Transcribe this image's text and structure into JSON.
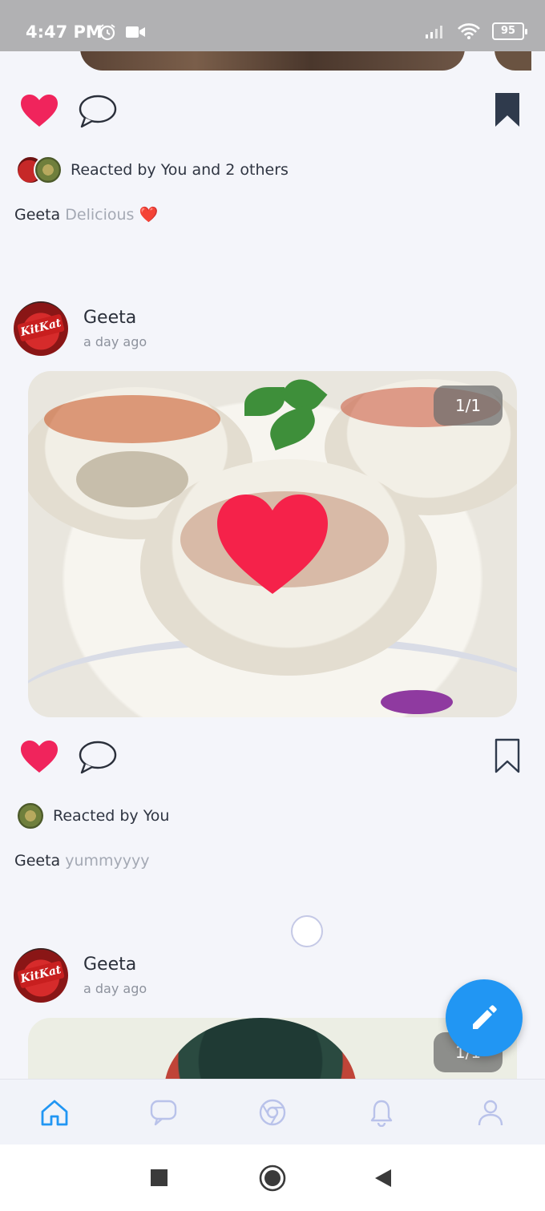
{
  "status_bar": {
    "time": "4:47 PM",
    "battery": "95",
    "icons": [
      "alarm-icon",
      "video-icon",
      "signal-icon",
      "wifi-icon",
      "battery-icon"
    ]
  },
  "feed": {
    "post_prev": {
      "reacted_text": "Reacted by You and 2 others",
      "caption_user": "Geeta",
      "caption_text": "Delicious ❤️",
      "liked": true,
      "saved": true
    },
    "post_main": {
      "username": "Geeta",
      "time_ago": "a day ago",
      "image_counter": "1/1",
      "reacted_text": "Reacted by You",
      "caption_user": "Geeta",
      "caption_text": "yummyyyy",
      "liked": true,
      "saved": false
    },
    "post_next": {
      "username": "Geeta",
      "time_ago": "a day ago",
      "image_counter": "1/1"
    }
  },
  "fab": {
    "icon": "pencil-icon"
  },
  "bottom_nav": {
    "items": [
      {
        "icon": "home-icon",
        "active": true
      },
      {
        "icon": "chat-icon",
        "active": false
      },
      {
        "icon": "explore-icon",
        "active": false
      },
      {
        "icon": "bell-icon",
        "active": false
      },
      {
        "icon": "profile-icon",
        "active": false
      }
    ]
  },
  "colors": {
    "accent": "#2196f3",
    "heart": "#f0245c",
    "inactive_nav": "#b9c2ea",
    "background": "#f4f5fa"
  }
}
